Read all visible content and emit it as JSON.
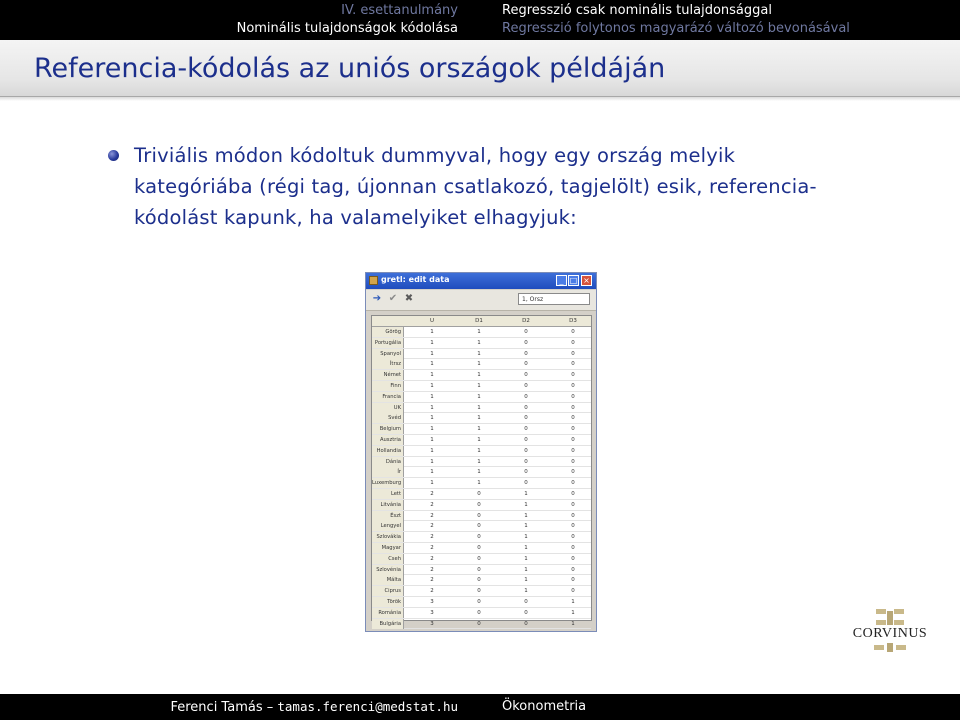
{
  "navigation": {
    "left_top": "IV. esettanulmány",
    "left_bottom": "Nominális tulajdonságok kódolása",
    "right_top": "Regresszió csak nominális tulajdonsággal",
    "right_bottom": "Regresszió folytonos magyarázó változó bevonásával"
  },
  "slide": {
    "title": "Referencia-kódolás az uniós országok példáján",
    "bullet": "Triviális módon kódoltuk dummyval, hogy egy ország melyik kategóriába (régi tag, újonnan csatlakozó, tagjelölt) esik, referencia-kódolást kapunk, ha valamelyiket elhagyjuk:"
  },
  "gretl": {
    "window_title": "gretl: edit data",
    "cell_ref": "1, Orsz",
    "columns": [
      "U",
      "D1",
      "D2",
      "D3"
    ],
    "rows": [
      {
        "name": "Görög",
        "values": [
          "1",
          "1",
          "0",
          "0"
        ]
      },
      {
        "name": "Portugália",
        "values": [
          "1",
          "1",
          "0",
          "0"
        ]
      },
      {
        "name": "Spanyol",
        "values": [
          "1",
          "1",
          "0",
          "0"
        ]
      },
      {
        "name": "Ítrsz",
        "values": [
          "1",
          "1",
          "0",
          "0"
        ]
      },
      {
        "name": "Német",
        "values": [
          "1",
          "1",
          "0",
          "0"
        ]
      },
      {
        "name": "Finn",
        "values": [
          "1",
          "1",
          "0",
          "0"
        ]
      },
      {
        "name": "Francia",
        "values": [
          "1",
          "1",
          "0",
          "0"
        ]
      },
      {
        "name": "UK",
        "values": [
          "1",
          "1",
          "0",
          "0"
        ]
      },
      {
        "name": "Svéd",
        "values": [
          "1",
          "1",
          "0",
          "0"
        ]
      },
      {
        "name": "Belgium",
        "values": [
          "1",
          "1",
          "0",
          "0"
        ]
      },
      {
        "name": "Ausztria",
        "values": [
          "1",
          "1",
          "0",
          "0"
        ]
      },
      {
        "name": "Hollandia",
        "values": [
          "1",
          "1",
          "0",
          "0"
        ]
      },
      {
        "name": "Dánia",
        "values": [
          "1",
          "1",
          "0",
          "0"
        ]
      },
      {
        "name": "Ír",
        "values": [
          "1",
          "1",
          "0",
          "0"
        ]
      },
      {
        "name": "Luxemburg",
        "values": [
          "1",
          "1",
          "0",
          "0"
        ]
      },
      {
        "name": "Lett",
        "values": [
          "2",
          "0",
          "1",
          "0"
        ]
      },
      {
        "name": "Litvánia",
        "values": [
          "2",
          "0",
          "1",
          "0"
        ]
      },
      {
        "name": "Észt",
        "values": [
          "2",
          "0",
          "1",
          "0"
        ]
      },
      {
        "name": "Lengyel",
        "values": [
          "2",
          "0",
          "1",
          "0"
        ]
      },
      {
        "name": "Szlovákia",
        "values": [
          "2",
          "0",
          "1",
          "0"
        ]
      },
      {
        "name": "Magyar",
        "values": [
          "2",
          "0",
          "1",
          "0"
        ]
      },
      {
        "name": "Cseh",
        "values": [
          "2",
          "0",
          "1",
          "0"
        ]
      },
      {
        "name": "Szlovénia",
        "values": [
          "2",
          "0",
          "1",
          "0"
        ]
      },
      {
        "name": "Málta",
        "values": [
          "2",
          "0",
          "1",
          "0"
        ]
      },
      {
        "name": "Ciprus",
        "values": [
          "2",
          "0",
          "1",
          "0"
        ]
      },
      {
        "name": "Török",
        "values": [
          "3",
          "0",
          "0",
          "1"
        ]
      },
      {
        "name": "Románia",
        "values": [
          "3",
          "0",
          "0",
          "1"
        ]
      },
      {
        "name": "Bulgária",
        "values": [
          "3",
          "0",
          "0",
          "1"
        ]
      }
    ]
  },
  "logo": {
    "text": "CORVINUS"
  },
  "footer": {
    "author": "Ferenci Tamás – ",
    "email": "tamas.ferenci@medstat.hu",
    "course": "Ökonometria"
  }
}
